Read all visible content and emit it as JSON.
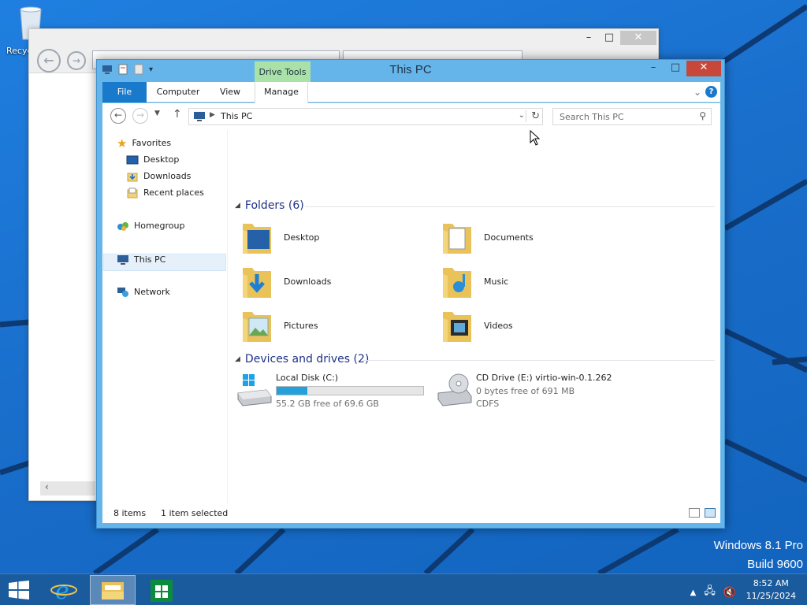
{
  "desktop": {
    "recycle_bin_label": "Recyc",
    "watermark_line1": "Windows 8.1 Pro",
    "watermark_line2": "Build 9600"
  },
  "explorer": {
    "title": "This PC",
    "contextual_tab_group": "Drive Tools",
    "ribbon_tabs": {
      "file": "File",
      "computer": "Computer",
      "view": "View",
      "manage": "Manage"
    },
    "address": {
      "breadcrumb": "This PC"
    },
    "search": {
      "placeholder": "Search This PC"
    },
    "nav_pane": {
      "favorites": "Favorites",
      "desktop": "Desktop",
      "downloads": "Downloads",
      "recent_places": "Recent places",
      "homegroup": "Homegroup",
      "this_pc": "This PC",
      "network": "Network"
    },
    "folders_group": {
      "heading": "Folders (6)",
      "items": [
        {
          "name": "Desktop"
        },
        {
          "name": "Documents"
        },
        {
          "name": "Downloads"
        },
        {
          "name": "Music"
        },
        {
          "name": "Pictures"
        },
        {
          "name": "Videos"
        }
      ]
    },
    "drives_group": {
      "heading": "Devices and drives (2)",
      "local_disk": {
        "name": "Local Disk (C:)",
        "free_text": "55.2 GB free of 69.6 GB",
        "used_fraction": 0.207
      },
      "cd_drive": {
        "name": "CD Drive (E:) virtio-win-0.1.262",
        "free_text": "0 bytes free of 691 MB",
        "filesystem": "CDFS"
      }
    },
    "status_bar": {
      "item_count": "8 items",
      "selection": "1 item selected"
    }
  },
  "taskbar": {
    "time": "8:52 AM",
    "date": "11/25/2024"
  },
  "colors": {
    "accent": "#1979ca",
    "window_frame": "#65b5ea",
    "close_button": "#c7483b",
    "contextual_tab": "#a9e1a7",
    "drive_bar": "#26a0da"
  }
}
